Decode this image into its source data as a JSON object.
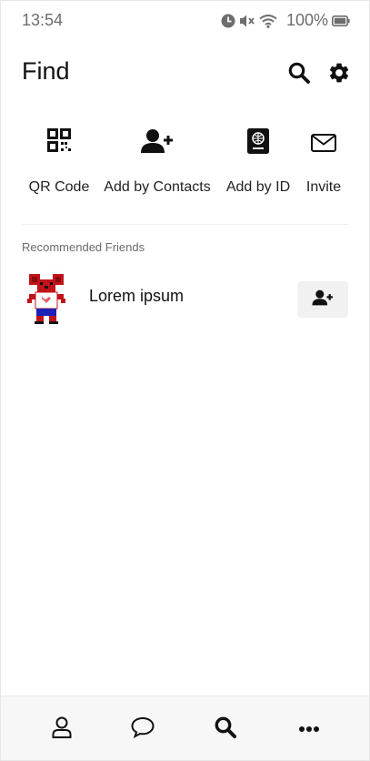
{
  "status_bar": {
    "time": "13:54",
    "battery": "100%",
    "icons": [
      "alarm-icon",
      "mute-icon",
      "wifi-icon",
      "battery-icon"
    ]
  },
  "header": {
    "title": "Find",
    "icons": [
      "search-icon",
      "gear-icon"
    ]
  },
  "actions": [
    {
      "label": "QR Code",
      "icon": "qr-code-icon"
    },
    {
      "label": "Add by Contacts",
      "icon": "add-user-icon"
    },
    {
      "label": "Add by ID",
      "icon": "id-book-icon"
    },
    {
      "label": "Invite",
      "icon": "envelope-icon"
    }
  ],
  "recommended": {
    "section_label": "Recommended Friends",
    "friends": [
      {
        "name": "Lorem ipsum",
        "avatar": "pixel-mouse-avatar",
        "action_icon": "add-user-icon"
      }
    ]
  },
  "bottom_nav": {
    "items": [
      {
        "icon": "person-icon",
        "active": false
      },
      {
        "icon": "chat-bubble-icon",
        "active": false
      },
      {
        "icon": "search-icon",
        "active": true
      },
      {
        "icon": "more-dots-icon",
        "active": false
      }
    ]
  },
  "colors": {
    "background": "#ffffff",
    "text": "#111111",
    "muted": "#6d6d6d",
    "button_bg": "#f1f1f1",
    "nav_bg": "#f7f7f7",
    "avatar_red": "#c0141a",
    "avatar_blue": "#1c22b8"
  }
}
